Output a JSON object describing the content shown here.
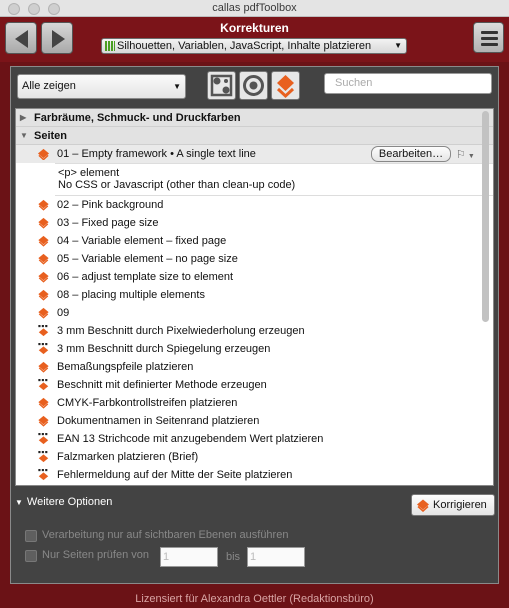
{
  "window": {
    "title": "callas pdfToolbox"
  },
  "header": {
    "title": "Korrekturen",
    "profile": "Silhouetten, Variablen, JavaScript, Inhalte platzieren"
  },
  "toolbar": {
    "filter": "Alle zeigen",
    "search_placeholder": "Suchen"
  },
  "list": {
    "groups": [
      {
        "label": "Farbräume, Schmuck- und Druckfarben",
        "expanded": false
      },
      {
        "label": "Seiten",
        "expanded": true
      }
    ],
    "selected_item": "01 – Empty framework • A single text line",
    "edit_button": "Bearbeiten…",
    "description": [
      "<p> element",
      "No CSS or Javascript (other than clean-up code)"
    ],
    "items": [
      "02 – Pink background",
      "03 – Fixed page size",
      "04 – Variable element – fixed page",
      "05 – Variable element – no page size",
      "06 – adjust template size to element",
      "08 – placing multiple elements",
      "09",
      "3 mm Beschnitt durch Pixelwiederholung erzeugen",
      "3 mm Beschnitt durch Spiegelung erzeugen",
      "Bemaßungspfeile platzieren",
      "Beschnitt mit definierter Methode erzeugen",
      "CMYK-Farbkontrollstreifen platzieren",
      "Dokumentnamen in Seitenrand platzieren",
      "EAN 13 Strichcode mit anzugebendem Wert platzieren",
      "Falzmarken platzieren (Brief)",
      "Fehlermeldung auf der Mitte der Seite platzieren"
    ]
  },
  "options": {
    "more_label": "Weitere Optionen",
    "fix_button": "Korrigieren",
    "visible_layers_label": "Verarbeitung nur auf sichtbaren Ebenen ausführen",
    "pages_label": "Nur Seiten prüfen von",
    "from_value": "1",
    "to_label": "bis",
    "to_value": "1"
  },
  "footer": {
    "license": "Lizensiert für Alexandra Oettler (Redaktionsbüro)"
  },
  "colors": {
    "accent": "#e8601f",
    "frame": "#7b1419",
    "panel": "#434343"
  }
}
